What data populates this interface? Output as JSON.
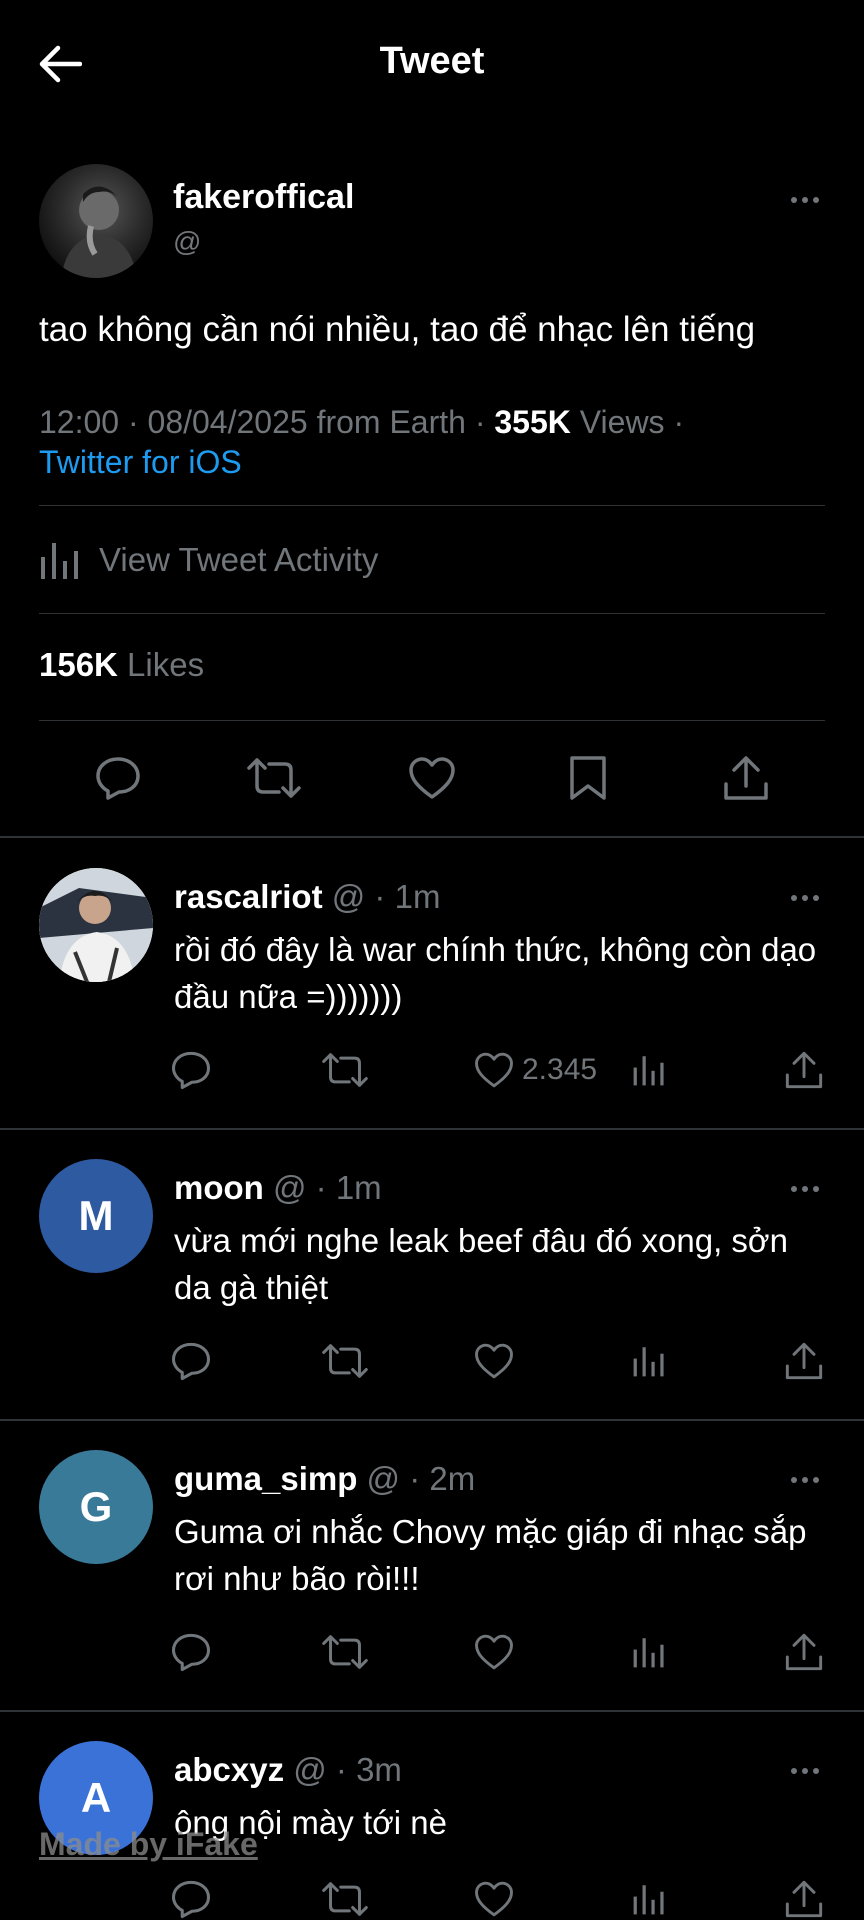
{
  "header": {
    "title": "Tweet",
    "back_icon": "arrow-left-icon"
  },
  "main_tweet": {
    "name": "fakeroffical",
    "handle": "@",
    "text": "tao không cần nói nhiều, tao để nhạc lên tiếng",
    "time_date": "12:00 · 08/04/2025 from Earth · ",
    "views_count": "355K",
    "views_label": " Views ·",
    "source": "Twitter for iOS",
    "activity_label": "View Tweet Activity",
    "likes_count": "156K",
    "likes_label": " Likes"
  },
  "replies": [
    {
      "name": "rascalriot",
      "meta": " @ · 1m",
      "text": "rồi đó đây là war chính thức, không còn dạo đầu nữa =)))))))",
      "like_count": "2.345",
      "avatar_type": "photo"
    },
    {
      "name": "moon",
      "meta": " @ · 1m",
      "text": "vừa mới nghe leak beef đâu đó xong, sởn da gà thiệt",
      "like_count": "",
      "avatar_letter": "M",
      "avatar_color": "#2d5aa0"
    },
    {
      "name": "guma_simp",
      "meta": " @ · 2m",
      "text": "Guma ơi nhắc Chovy mặc giáp đi nhạc sắp rơi như bão ròi!!!",
      "like_count": "",
      "avatar_letter": "G",
      "avatar_color": "#3a7a99"
    },
    {
      "name": "abcxyz",
      "meta": " @ · 3m",
      "text": "ông nội mày tới nè",
      "like_count": "",
      "avatar_letter": "A",
      "avatar_color": "#3a72d8"
    }
  ],
  "watermark": "Made by iFake",
  "colors": {
    "background": "#000000",
    "link": "#1d9bf0",
    "muted": "#71767b",
    "divider": "#2f3336"
  }
}
